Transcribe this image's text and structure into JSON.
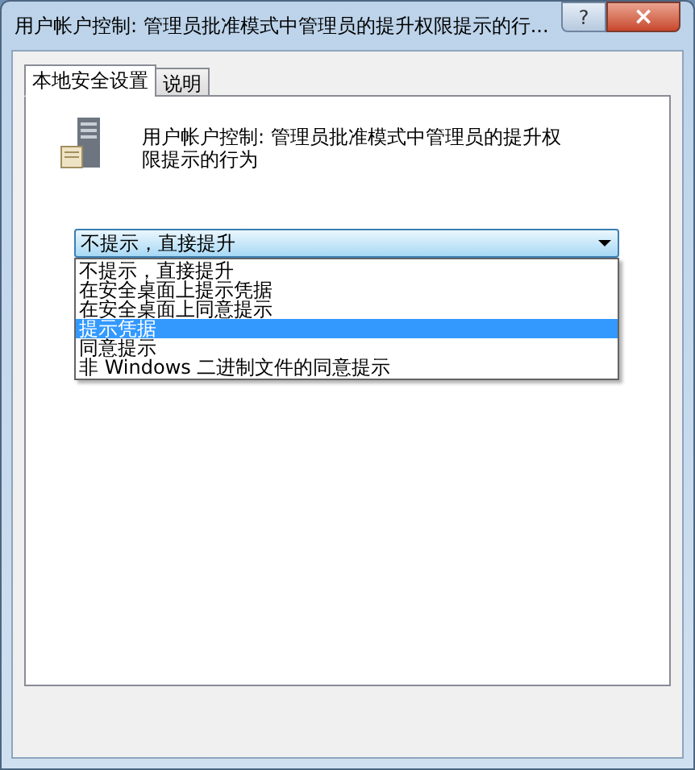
{
  "window": {
    "title": "用户帐户控制: 管理员批准模式中管理员的提升权限提示的行...",
    "help_button": "?",
    "close_button": "×"
  },
  "tabs": [
    {
      "label": "本地安全设置",
      "selected": true
    },
    {
      "label": "说明",
      "selected": false
    }
  ],
  "policy_description": "用户帐户控制: 管理员批准模式中管理员的提升权限提示的行为",
  "dropdown": {
    "value": "不提示，直接提升",
    "expanded": true,
    "options": [
      {
        "label": "不提示，直接提升",
        "highlighted": false
      },
      {
        "label": "在安全桌面上提示凭据",
        "highlighted": false
      },
      {
        "label": "在安全桌面上同意提示",
        "highlighted": false
      },
      {
        "label": "提示凭据",
        "highlighted": true
      },
      {
        "label": "同意提示",
        "highlighted": false
      },
      {
        "label": "非 Windows 二进制文件的同意提示",
        "highlighted": false
      }
    ]
  }
}
